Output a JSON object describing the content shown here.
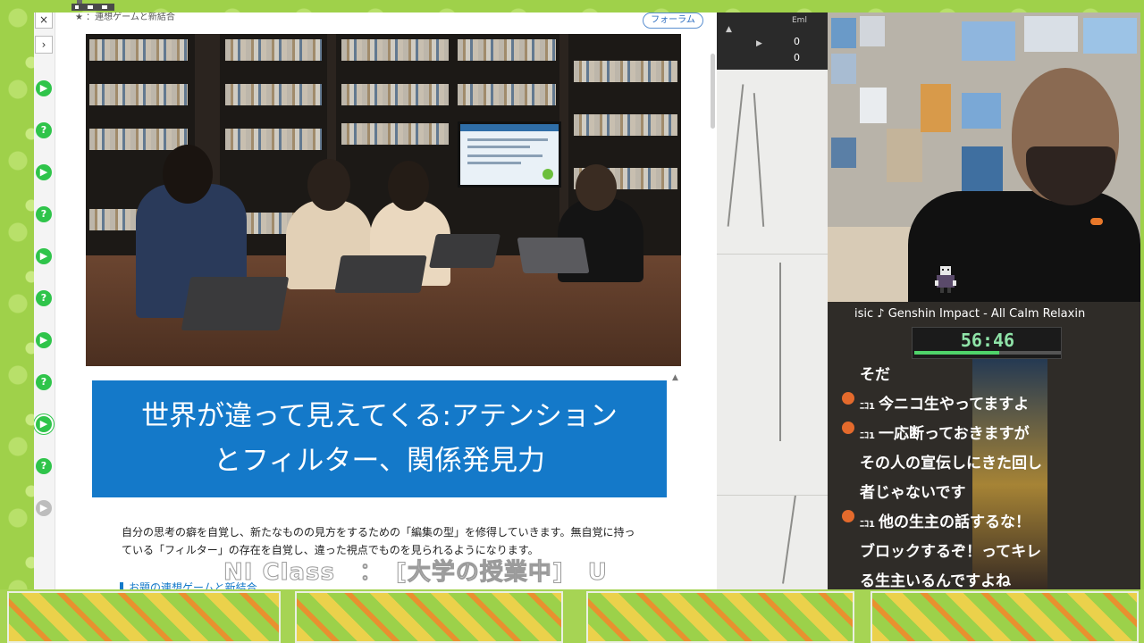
{
  "browser": {
    "breadcrumb": "★ ：連想ゲームと新結合",
    "forum_button": "フォーラム",
    "rail_close": "×",
    "rail_expand": "›",
    "rail_items": [
      {
        "type": "play",
        "glyph": "▶"
      },
      {
        "type": "quiz",
        "glyph": "?"
      },
      {
        "type": "play",
        "glyph": "▶"
      },
      {
        "type": "quiz",
        "glyph": "?"
      },
      {
        "type": "play",
        "glyph": "▶"
      },
      {
        "type": "quiz",
        "glyph": "?"
      },
      {
        "type": "play",
        "glyph": "▶"
      },
      {
        "type": "quiz",
        "glyph": "?"
      },
      {
        "type": "play-current",
        "glyph": "▶"
      },
      {
        "type": "quiz",
        "glyph": "?"
      },
      {
        "type": "locked",
        "glyph": "▶"
      }
    ],
    "lesson_title_line1": "世界が違って見えてくる:アテンション",
    "lesson_title_line2": "とフィルター、関係発見力",
    "description": "自分の思考の癖を自覚し、新たなものの見方をするための「編集の型」を修得していきます。無自覚に持っている「フィルター」の存在を自覚し、違った視点でものを見られるようになります。",
    "next_heading": "お題の連想ゲームと新結合",
    "scroll_up": "▲"
  },
  "sketch_panel": {
    "readouts": [
      "Eml",
      "0",
      "0"
    ]
  },
  "stream": {
    "now_playing": "isic ♪ Genshin Impact - All Calm  Relaxin",
    "timer": "56:46",
    "timer_progress": 0.58,
    "chat": [
      {
        "prefix": "",
        "text": "そだ",
        "tag": false
      },
      {
        "prefix": "ﾆｺ1",
        "text": "今ニコ生やってますよ",
        "tag": true
      },
      {
        "prefix": "ﾆｺ1",
        "text": "一応断っておきますが",
        "tag": true
      },
      {
        "prefix": "",
        "text": "その人の宣伝しにきた回し",
        "tag": false
      },
      {
        "prefix": "",
        "text": "者じゃないです",
        "tag": false
      },
      {
        "prefix": "ﾆｺ1",
        "text": "他の生主の話するな！",
        "tag": true
      },
      {
        "prefix": "",
        "text": "ブロックするぞ！ってキレ",
        "tag": false
      },
      {
        "prefix": "",
        "text": "る生主いるんですよね",
        "tag": false
      }
    ]
  },
  "overlay": {
    "subtitle": "NI Class　：　[大学の授業中]　U"
  },
  "colors": {
    "accent_blue": "#1479c9",
    "rail_green": "#2fc44a",
    "timer_green": "#8fe3a8",
    "chat_tag_orange": "#e46a2c"
  }
}
